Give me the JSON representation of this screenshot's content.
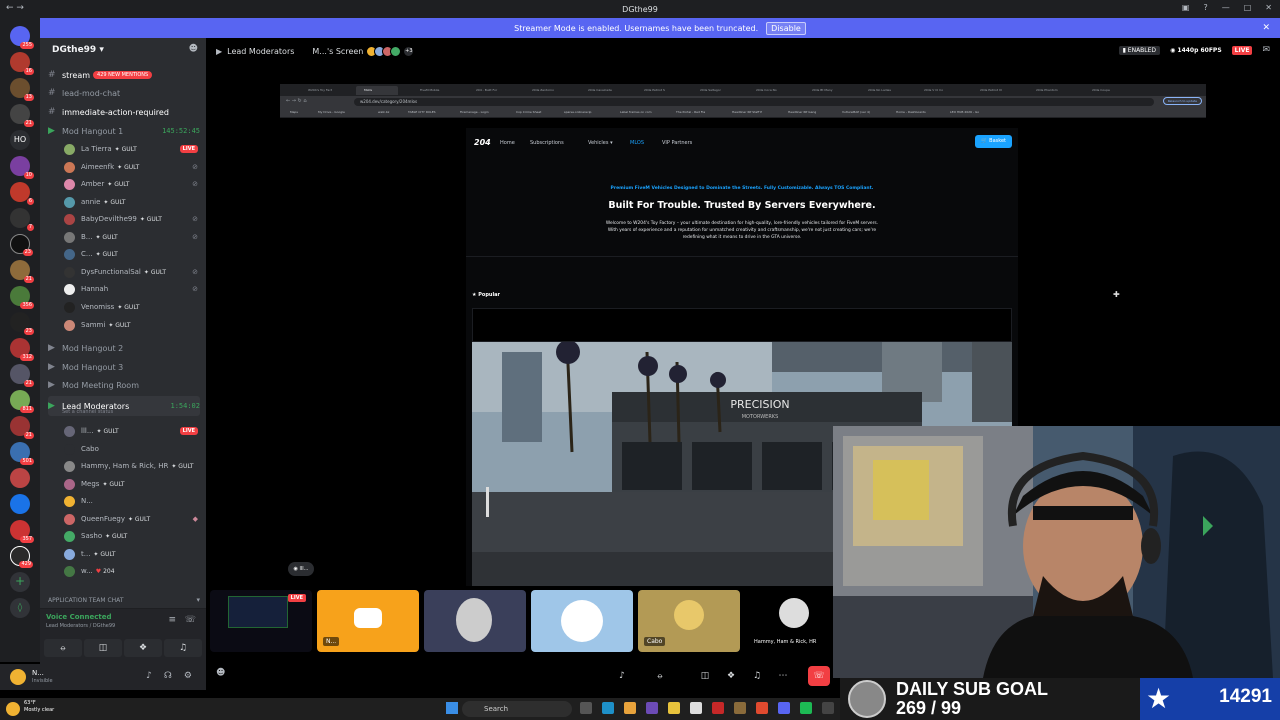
{
  "window": {
    "title": "DGthe99"
  },
  "banner": {
    "text": "Streamer Mode is enabled. Usernames have been truncated.",
    "button": "Disable"
  },
  "guild": {
    "name": "DGthe99"
  },
  "server_badges": [
    "255",
    "16",
    "13",
    "21",
    "",
    "10",
    "6",
    "7",
    "23",
    "21",
    "356",
    "23",
    "312",
    "21",
    "811",
    "21",
    "501",
    "",
    "357",
    "429",
    ""
  ],
  "channels": [
    {
      "name": "stream",
      "pill": "429 NEW MENTIONS",
      "type": "text"
    },
    {
      "name": "lead-mod-chat",
      "type": "text"
    },
    {
      "name": "immediate-action-required",
      "type": "text"
    }
  ],
  "voice1": {
    "name": "Mod Hangout 1",
    "time": "145:52:45"
  },
  "voice1_members": [
    {
      "name": "La Tierra",
      "tag": "GULT",
      "live": "LIVE"
    },
    {
      "name": "Aimeenfk",
      "tag": "GULT"
    },
    {
      "name": "Amber",
      "tag": "GULT"
    },
    {
      "name": "annie",
      "tag": "GULT"
    },
    {
      "name": "BabyDevilthe99",
      "tag": "GULT"
    },
    {
      "name": "B...",
      "tag": "GULT"
    },
    {
      "name": "C...",
      "tag": "GULT"
    },
    {
      "name": "DysFunctionalSal",
      "tag": "GULT"
    },
    {
      "name": "Hannah",
      "tag": ""
    },
    {
      "name": "Venomiss",
      "tag": "GULT"
    },
    {
      "name": "Sammi",
      "tag": "GULT"
    }
  ],
  "voice_channels": [
    "Mod Hangout 2",
    "Mod Hangout 3",
    "Mod Meeting Room"
  ],
  "voice_active": {
    "name": "Lead Moderators",
    "time": "1:54:02",
    "sub": "Set a channel status"
  },
  "active_members": [
    {
      "name": "lll...",
      "tag": "GULT",
      "live": "LIVE"
    },
    {
      "name": "Cabo",
      "tag": ""
    },
    {
      "name": "Hammy, Ham & Rick, HR",
      "tag": "GULT"
    },
    {
      "name": "Megs",
      "tag": "GULT"
    },
    {
      "name": "N...",
      "tag": ""
    },
    {
      "name": "QueenFuegy",
      "tag": "GULT"
    },
    {
      "name": "Sasho",
      "tag": "GULT"
    },
    {
      "name": "t...",
      "tag": "GULT"
    },
    {
      "name": "w...",
      "tag": "204"
    }
  ],
  "category": "Application Team Chat",
  "voice_connected": {
    "status": "Voice Connected",
    "channel": "Lead Moderators / DGthe99"
  },
  "user": {
    "name": "N...",
    "status": "Invisible"
  },
  "stage": {
    "channel": "Lead Moderators",
    "screen": "M...'s Screen",
    "plus": "+3",
    "enabled": "ENABLED",
    "quality": "1440p 60FPS",
    "live": "LIVE"
  },
  "browser": {
    "url": "w204.dev/category/204mlos",
    "update": "Relaunch to update",
    "tabs": [
      "W204's Toy Fact",
      "MLOs",
      "FiveM Mobile",
      "204 - Built For",
      "204s Zentorno",
      "204s Cavalcade",
      "204s Patriot S",
      "204s Saltagor",
      "204s Coca No",
      "204s Bt Many",
      "204s No Ladies",
      "204s V Cl Co",
      "204s Patriot III",
      "204s Phantom",
      "204s Coupe"
    ],
    "bookmarks": [
      "Maps",
      "My Drive - Google",
      "walk.bz",
      "TABLE CITY RULES",
      "Firemanage - Login",
      "Cop Crime Sheet",
      "sparse.onlinerecip",
      "Label frames on com",
      "The Portal - Red Fla",
      "Headliner RP Staff P",
      "Headliner RP Gang",
      "VultureMAP (ver 4)",
      "Home - Dashboards",
      "LEO HUB 2026 - Go"
    ]
  },
  "site": {
    "logo": "204",
    "nav": [
      "Home",
      "Subscriptions",
      "Vehicles",
      "MLOS",
      "VIP Partners"
    ],
    "basket": "Basket",
    "kicker": "Premium FiveM Vehicles Designed to Dominate the Streets. Fully Customizable. Always TOS Compliant.",
    "title": "Built For Trouble. Trusted By Servers Everywhere.",
    "body": "Welcome to W204's Toy Factory – your ultimate destination for high-quality, lore-friendly vehicles tailored for FiveM servers. With years of experience and a reputation for unmatched creativity and craftsmanship, we're not just creating cars; we're redefining what it means to drive in the GTA universe.",
    "popular": "Popular",
    "building_sign": "PRECISION",
    "building_sub": "MOTORWERKS"
  },
  "tiles": [
    {
      "label": "",
      "live": "LIVE"
    },
    {
      "label": "N..."
    },
    {
      "label": ""
    },
    {
      "label": ""
    },
    {
      "label": "Cabo"
    },
    {
      "label": "Hammy, Ham & Rick, HR"
    }
  ],
  "overlay": {
    "title": "DAILY SUB GOAL",
    "progress": "269 / 99",
    "count": "14291"
  },
  "taskbar": {
    "temp": "63°F",
    "weather": "Mostly clear",
    "search": "Search"
  },
  "colors": {
    "accent": "#5865f2",
    "live": "#f23f43",
    "voice": "#3ba55c",
    "site_blue": "#1aa3ff"
  }
}
